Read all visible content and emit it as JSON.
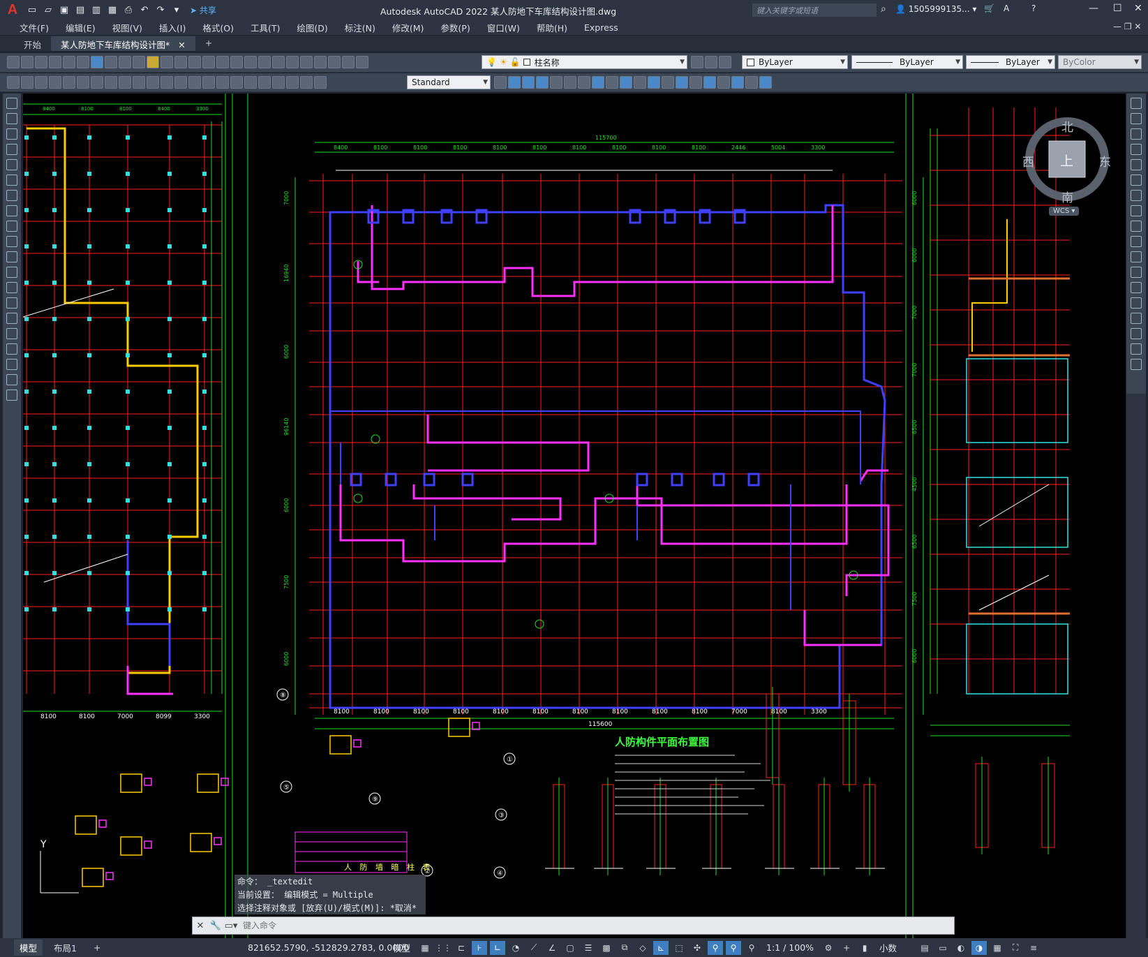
{
  "app": {
    "logo": "A",
    "title": "Autodesk AutoCAD 2022    某人防地下车库结构设计图.dwg",
    "share_label": "共享",
    "search_placeholder": "键入关键字或短语",
    "user": "1505999135...",
    "window_controls": [
      "—",
      "☐",
      "✕"
    ]
  },
  "menu": [
    "文件(F)",
    "编辑(E)",
    "视图(V)",
    "插入(I)",
    "格式(O)",
    "工具(T)",
    "绘图(D)",
    "标注(N)",
    "修改(M)",
    "参数(P)",
    "窗口(W)",
    "帮助(H)",
    "Express"
  ],
  "doc_tabs": [
    {
      "label": "开始",
      "active": false
    },
    {
      "label": "某人防地下车库结构设计图*",
      "active": true
    }
  ],
  "toolbar": {
    "layer": "柱名称",
    "color": "ByLayer",
    "linetype": "ByLayer",
    "lineweight": "ByLayer",
    "plotstyle": "ByColor",
    "textstyle": "Standard"
  },
  "viewcube": {
    "north": "北",
    "south": "南",
    "east": "东",
    "west": "西",
    "top": "上",
    "wcs": "WCS"
  },
  "drawing": {
    "main_title": "人防构件平面布置图",
    "top_dims": [
      "8400",
      "8100",
      "8100",
      "8100",
      "8100",
      "8100",
      "8100",
      "8100",
      "8100",
      "8100",
      "2446",
      "5004",
      "3300"
    ],
    "top_total": "115700",
    "bottom_dims": [
      "8100",
      "8100",
      "8100",
      "8100",
      "8100",
      "8100",
      "8100",
      "8100",
      "8100",
      "8100",
      "7000",
      "8100",
      "3300"
    ],
    "bottom_total": "115600",
    "left_dims": [
      "7000",
      "16940",
      "6000",
      "96140",
      "6000",
      "7500",
      "6000"
    ],
    "right_dims": [
      "6000",
      "6000",
      "7000",
      "7000",
      "6500",
      "4500",
      "6500",
      "7500",
      "6000"
    ],
    "left_panel_dims": [
      "8100",
      "8100",
      "7000",
      "8099",
      "3300"
    ],
    "left_panel_top_dims": [
      "8400",
      "8100",
      "8100",
      "8400",
      "3300"
    ],
    "detail_labels": [
      "①",
      "②",
      "③",
      "④",
      "⑤",
      "⑧",
      "⑨"
    ],
    "table_title": "人 防 墙 暗 柱 表"
  },
  "command": {
    "history": [
      "命令： _textedit",
      "当前设置： 编辑模式 = Multiple",
      "选择注释对象或 [放弃(U)/模式(M)]: *取消*"
    ],
    "placeholder": "键入命令"
  },
  "layout_tabs": [
    {
      "label": "模型",
      "active": true
    },
    {
      "label": "布局1",
      "active": false
    },
    {
      "label": "+",
      "active": false
    }
  ],
  "status": {
    "coords": "821652.5790, -512829.2783, 0.0000",
    "model_label": "模型",
    "scale": "1:1 / 100%",
    "units": "小数"
  },
  "colors": {
    "background": "#000000",
    "grid_red": "#ff2020",
    "dim_green": "#20e020",
    "wall_magenta": "#ff30ff",
    "wall_blue": "#4040ff",
    "yellow": "#ffcc00",
    "cyan": "#30e0e0"
  }
}
